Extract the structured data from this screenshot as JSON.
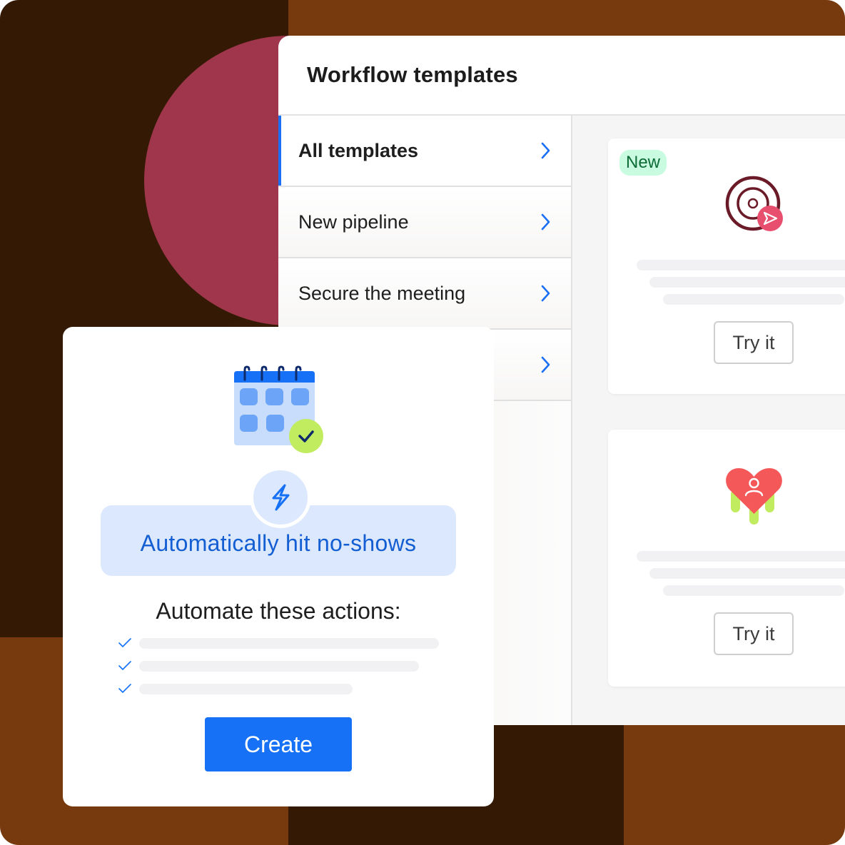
{
  "panel": {
    "title": "Workflow templates"
  },
  "sidebar": {
    "items": [
      {
        "label": "All templates",
        "active": true
      },
      {
        "label": "New pipeline",
        "active": false
      },
      {
        "label": "Secure the meeting",
        "active": false
      },
      {
        "label": "",
        "active": false
      }
    ]
  },
  "templates": [
    {
      "badge": "New",
      "icon": "target-send-icon",
      "button_label": "Try it"
    },
    {
      "badge": "",
      "icon": "heart-person-icon",
      "button_label": "Try it"
    }
  ],
  "popup": {
    "icon": "calendar-check-icon",
    "trigger_icon": "lightning-bolt-icon",
    "banner_text": "Automatically hit no-shows",
    "actions_title": "Automate these actions:",
    "action_count": 3,
    "create_label": "Create"
  },
  "colors": {
    "accent_blue": "#1671f6",
    "banner_bg": "#dce8fd",
    "banner_text": "#135ed2",
    "badge_bg": "#c9fbe0",
    "badge_text": "#0b6b35",
    "bg_dark": "#341904",
    "bg_orange": "#773a0e",
    "circle": "#a0364b"
  }
}
